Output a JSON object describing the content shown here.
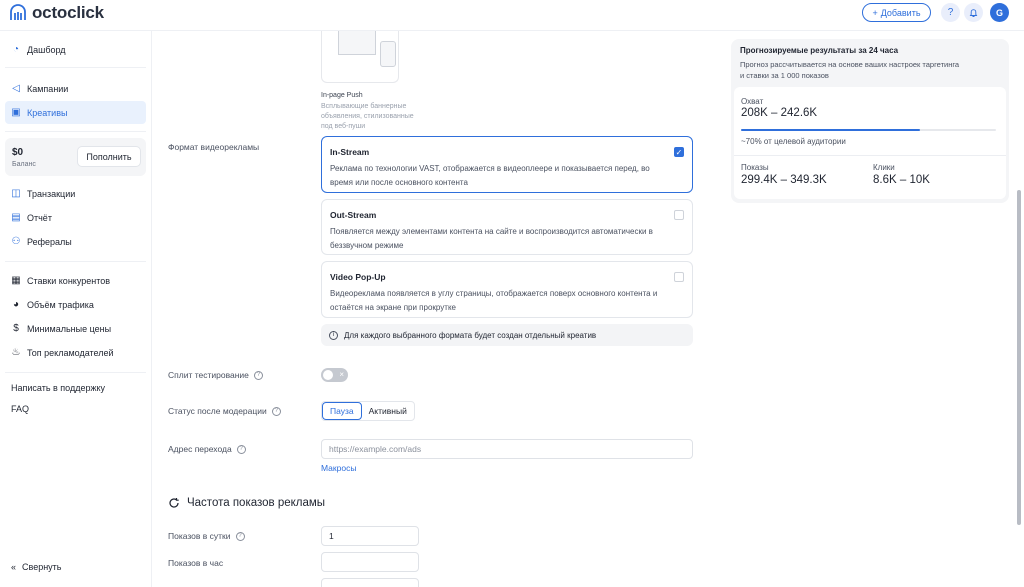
{
  "header": {
    "logo_text": "octoclick",
    "add_label": "Добавить",
    "avatar_letter": "G"
  },
  "sidebar": {
    "items": [
      {
        "label": "Дашборд",
        "icon": "chart-pie-icon"
      },
      {
        "label": "Кампании",
        "icon": "megaphone-icon"
      },
      {
        "label": "Креативы",
        "icon": "image-icon",
        "active": true
      },
      {
        "label": "Транзакции",
        "icon": "wallet-icon"
      },
      {
        "label": "Отчёт",
        "icon": "document-icon"
      },
      {
        "label": "Рефералы",
        "icon": "users-icon"
      },
      {
        "label": "Ставки конкурентов",
        "icon": "table-icon"
      },
      {
        "label": "Объём трафика",
        "icon": "pie-icon"
      },
      {
        "label": "Минимальные цены",
        "icon": "dollar-icon"
      },
      {
        "label": "Топ рекламодателей",
        "icon": "fire-icon"
      }
    ],
    "balance_amount": "$0",
    "balance_label": "Баланс",
    "topup_label": "Пополнить",
    "support_label": "Написать в поддержку",
    "faq_label": "FAQ",
    "collapse_label": "Свернуть"
  },
  "main": {
    "thumb_title": "In-page Push",
    "thumb_desc": "Всплывающие баннерные объявления, стилизованные под веб-пуши",
    "format_label": "Формат видеорекламы",
    "formats": [
      {
        "title": "In-Stream",
        "desc": "Реклама по технологии VAST, отображается в видеоплеере и показывается перед, во время или после основного контента",
        "checked": true
      },
      {
        "title": "Out-Stream",
        "desc": "Появляется между элементами контента на сайте и воспроизводится автоматически в беззвучном режиме",
        "checked": false
      },
      {
        "title": "Video Pop-Up",
        "desc": "Видеореклама появляется в углу страницы, отображается поверх основного контента и остаётся на экране при прокрутке",
        "checked": false
      }
    ],
    "format_note": "Для каждого выбранного формата будет создан отдельный креатив",
    "split_label": "Сплит тестирование",
    "status_label": "Статус после модерации",
    "status_options": [
      "Пауза",
      "Активный"
    ],
    "url_label": "Адрес перехода",
    "url_placeholder": "https://example.com/ads",
    "macros_label": "Макросы",
    "freq_title": "Частота показов рекламы",
    "per_day_label": "Показов в сутки",
    "per_day_value": "1",
    "per_hour_label": "Показов в час"
  },
  "forecast": {
    "title": "Прогнозируемые результаты за 24 часа",
    "subtitle": "Прогноз рассчитывается на основе ваших настроек таргетинга и ставки за 1 000 показов",
    "reach_label": "Охват",
    "reach_value": "208K – 242.6K",
    "reach_fraction": 0.7,
    "reach_note": "~70% от целевой аудитории",
    "impressions_label": "Показы",
    "impressions_value": "299.4K – 349.3K",
    "clicks_label": "Клики",
    "clicks_value": "8.6K – 10K"
  },
  "colors": {
    "accent": "#2f6fdb"
  }
}
